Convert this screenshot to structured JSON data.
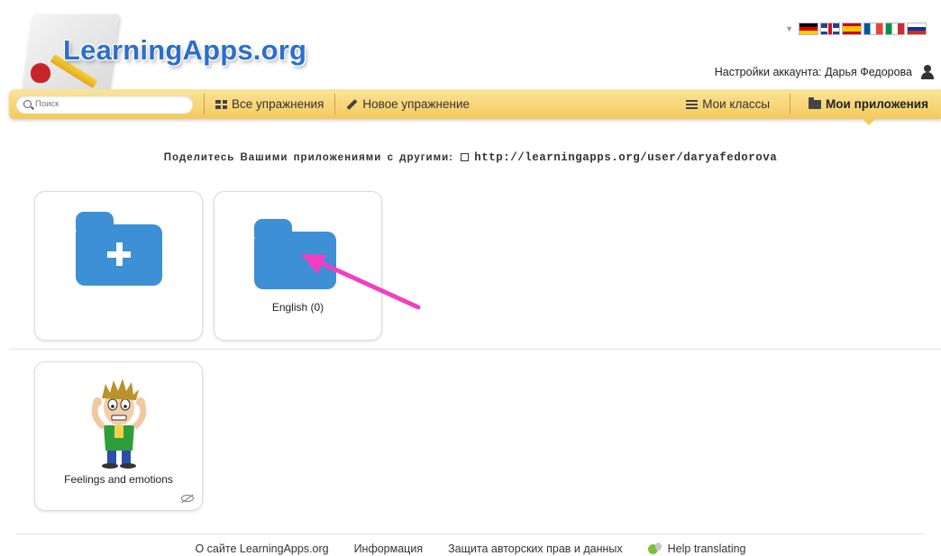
{
  "header": {
    "logo_text": "LearningApps.org",
    "account_label": "Настройки аккаунта: Дарья Федорова"
  },
  "languages": [
    "de",
    "gb",
    "es",
    "fr",
    "it",
    "ru"
  ],
  "nav": {
    "search_placeholder": "Поиск",
    "all_exercises": "Все упражнения",
    "new_exercise": "Новое упражнение",
    "my_classes": "Мои классы",
    "my_apps": "Мои приложения",
    "active": "my_apps"
  },
  "share": {
    "label": "Поделитесь Вашими приложениями с другими:",
    "url": "http://learningapps.org/user/daryafedorova"
  },
  "folders": [
    {
      "label": "",
      "kind": "new-folder"
    },
    {
      "label": "English (0)",
      "kind": "folder"
    }
  ],
  "apps": [
    {
      "label": "Feelings and emotions",
      "thumbnail": "boy-cartoon"
    }
  ],
  "footer": {
    "about": "О сайте LearningApps.org",
    "info": "Информация",
    "privacy": "Защита авторских прав и данных",
    "help": "Help translating"
  },
  "colors": {
    "folder": "#3d8fd6",
    "navbar": "#f4c95c",
    "logo": "#2d6fc8",
    "annotation_arrow": "#f23fc0"
  }
}
